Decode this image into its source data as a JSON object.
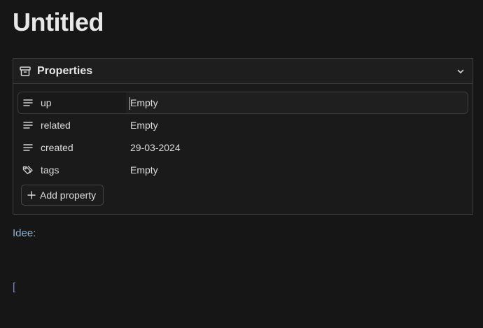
{
  "note": {
    "title": "Untitled"
  },
  "properties": {
    "header_label": "Properties",
    "header_icon": "archive-icon",
    "collapse_icon": "chevron-down-icon",
    "rows": [
      {
        "key": "up",
        "icon": "text-lines-icon",
        "value": "Empty"
      },
      {
        "key": "related",
        "icon": "text-lines-icon",
        "value": "Empty"
      },
      {
        "key": "created",
        "icon": "text-lines-icon",
        "value": "29-03-2024"
      },
      {
        "key": "tags",
        "icon": "tags-icon",
        "value": "Empty"
      }
    ],
    "add_label": "Add property"
  },
  "body": {
    "line1": "Idee:",
    "line2": "["
  },
  "colors": {
    "background": "#161616",
    "panel_border": "#3a3a3a",
    "link_text": "#8fb3cf",
    "bracket_text": "#7a8fb8"
  }
}
